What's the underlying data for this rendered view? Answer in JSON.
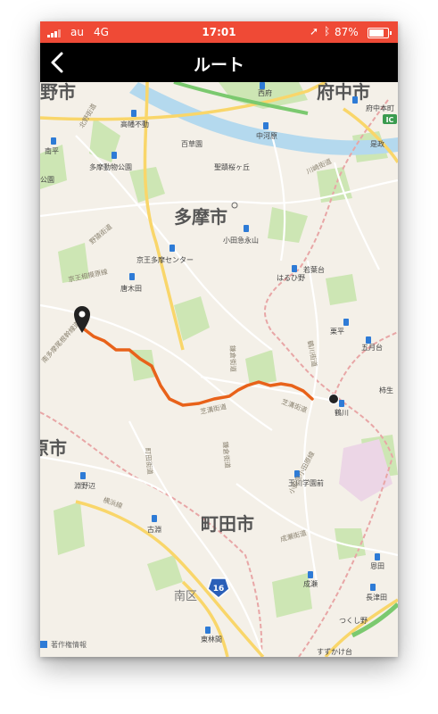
{
  "status_bar": {
    "carrier": "au",
    "network": "4G",
    "time": "17:01",
    "battery_percent": "87%",
    "battery_level": 0.87,
    "accent_color": "#ef4a36"
  },
  "nav_bar": {
    "title": "ルート",
    "back_icon": "chevron-left-icon"
  },
  "map": {
    "route_color": "#e8621a",
    "city_labels": {
      "tama": "多摩市",
      "machida": "町田市",
      "fuchu": "府中市",
      "hino": "野市",
      "sagamihara": "原市"
    },
    "district_labels": {
      "minami_ku": "南区"
    },
    "stations": {
      "takahata_fudo": "高幡不動",
      "tama_dobutsu_koen": "多摩動物公園",
      "minamidaira": "南平",
      "keio_tama_center": "京王多摩センター",
      "karakida": "唐木田",
      "chuo_kouen": "公園",
      "nishifu": "西府",
      "fuchu_honmachi": "府中本町",
      "nakagawara": "中河原",
      "seiseki_sakuragaoka": "聖蹟桜ヶ丘",
      "odakyu_nagayama": "小田急永山",
      "wakabadai": "若葉台",
      "haruhino": "はるひ野",
      "kurihira": "栗平",
      "satsukidai": "五月台",
      "kakio": "柿生",
      "tsurukawa": "鶴川",
      "tamagawa_gakuenmae": "玉川学園前",
      "fuchinobe": "淵野辺",
      "kobuchi": "古淵",
      "naruse": "成瀬",
      "onda": "恩田",
      "nagatsuta": "長津田",
      "tsukushino": "つくし野",
      "suzukakedai": "すずかけ台",
      "higashi_rinkan": "東林間",
      "yakumo_en": "百草園",
      "koremasa": "是政"
    },
    "road_labels": {
      "kitano_kaido": "北野街道",
      "nogawa_kaido": "野猿街道",
      "kawasaki_kaido": "川崎街道",
      "minami_tama_one": "南多摩尾根幹線道路",
      "keio_sagamihara": "京王相模原線",
      "shibamizo_1": "芝溝街道",
      "shibamizo_2": "芝溝街道",
      "kamakura_kaido": "鎌倉街道",
      "tsurukawa_kaido": "鶴川街道",
      "machida_kaido": "町田街道",
      "kamakura_kaido_2": "鎌倉街道",
      "odakyu_odawara": "小田急小田原線",
      "yokohama_line": "横浜線",
      "naruse_kaido": "成瀬街道"
    },
    "route_number": "16",
    "ic_label": "IC",
    "copyright": "著作権情報"
  }
}
